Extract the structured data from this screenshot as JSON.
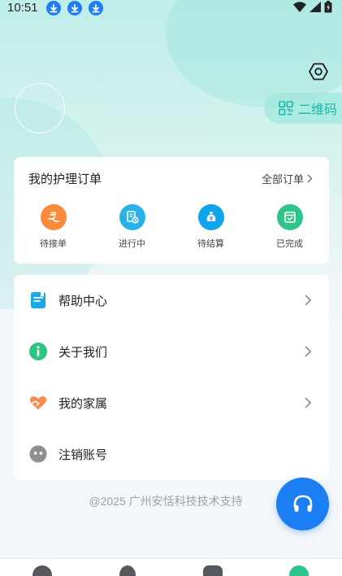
{
  "status_bar": {
    "time": "10:51"
  },
  "header": {
    "qr_label": "二维码"
  },
  "orders": {
    "title": "我的护理订单",
    "all_label": "全部订单",
    "statuses": [
      {
        "label": "待接单",
        "color": "#fb8a3c",
        "icon": "hand-icon"
      },
      {
        "label": "进行中",
        "color": "#27b3e7",
        "icon": "document-clock-icon"
      },
      {
        "label": "待结算",
        "color": "#0fa4ec",
        "icon": "money-bag-icon"
      },
      {
        "label": "已完成",
        "color": "#2fc58a",
        "icon": "check-box-icon"
      }
    ]
  },
  "menu": {
    "items": [
      {
        "label": "帮助中心",
        "icon": "book-icon"
      },
      {
        "label": "关于我们",
        "icon": "info-icon"
      },
      {
        "label": "我的家属",
        "icon": "heart-icon"
      },
      {
        "label": "注销账号",
        "icon": "face-icon"
      }
    ]
  },
  "footer": {
    "text": "@2025 广州安恬科技技术支持"
  },
  "colors": {
    "accent": "#1c7ef3",
    "teal": "#16b9a6"
  }
}
